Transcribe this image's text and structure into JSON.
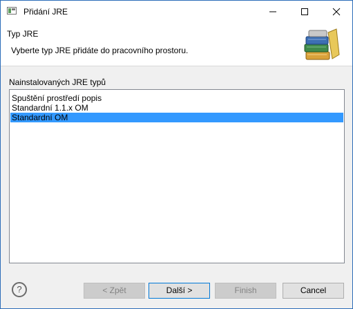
{
  "window": {
    "title": "Přidání JRE",
    "minimize_icon": "minimize-icon",
    "maximize_icon": "maximize-icon",
    "close_icon": "close-icon"
  },
  "header": {
    "title": "Typ JRE",
    "description": "Vyberte typ JRE přidáte do pracovního prostoru.",
    "art_icon": "books-library-icon"
  },
  "list": {
    "label": "Nainstalovaných JRE typů",
    "items": [
      {
        "label": "Spuštění prostředí popis",
        "selected": false
      },
      {
        "label": "Standardní 1.1.x OM",
        "selected": false
      },
      {
        "label": "Standardní OM",
        "selected": true
      }
    ]
  },
  "buttons": {
    "help_icon": "?",
    "back": "< Zpět",
    "next": "Další >",
    "finish": "Finish",
    "cancel": "Cancel"
  },
  "colors": {
    "selection": "#3399ff",
    "window_border": "#2b6cb8"
  }
}
